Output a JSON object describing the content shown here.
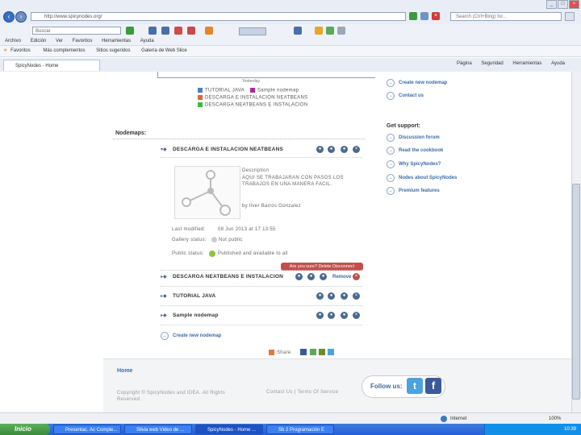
{
  "browser": {
    "address": "http://www.spicynodes.org/",
    "search_placeholder": "Search  (Ctrl+Bing) for...",
    "toolbar_search": "Buscar",
    "menu": [
      "Archivo",
      "Edición",
      "Ver",
      "Favoritos",
      "Herramientas",
      "Ayuda"
    ],
    "favorites_label": "Favoritos",
    "fav_items": [
      "Más complementos",
      "Sitios sugeridos",
      "Galería de Web Slice"
    ],
    "tab_label": "SpicyNodes - Home",
    "cmd_items": [
      "Página",
      "Seguridad",
      "Herramientas",
      "Ayuda"
    ],
    "status_text": "Internet"
  },
  "legend": {
    "items": [
      {
        "label": "TUTORIAL JAVA",
        "color": "#4a7fc1"
      },
      {
        "label": "Sample nodemap",
        "color": "#b3269b"
      },
      {
        "label": "DESCARGA E INSTALACION NEATBEANS",
        "color": "#d86a3c"
      },
      {
        "label": "DESCARGA NEATBEANS E INSTALACION",
        "color": "#33c133"
      }
    ],
    "axis_caption": "Yesterday"
  },
  "nodemaps": {
    "heading": "Nodemaps:",
    "rows": [
      {
        "title": "DESCARGA E INSTALACION NEATBEANS"
      },
      {
        "title": "DESCARGA NEATBEANS E INSTALACION"
      },
      {
        "title": "TUTORIAL JAVA"
      },
      {
        "title": "Sample nodemap"
      }
    ],
    "details": {
      "desc_label": "Description",
      "desc_text": "AQUI SE TRABAJARAN CON PASOS LOS TRABAJOS EN UNA MANERA FACIL.",
      "author": "by Ilver Barros Gonzalez",
      "last_modified_label": "Last modified:",
      "last_modified_value": "08 Jun 2013 at 17:13:55",
      "gallery_label": "Gallery status:",
      "gallery_value": "Not public",
      "public_label": "Public status:",
      "public_value": "Published and available to all"
    },
    "confirm": "Are you sure? Delete  Disconnect",
    "remove": "Remove",
    "create_link": "Create new nodemap",
    "share": "Share"
  },
  "sidebar": {
    "top_links": [
      "Create new nodemap",
      "Contact us"
    ],
    "support_heading": "Get support:",
    "support_links": [
      "Discussion forum",
      "Read the cookbook",
      "Why SpicyNodes?",
      "Nodes about SpicyNodes",
      "Premium features"
    ]
  },
  "footer": {
    "home": "Home",
    "copyright": "Copyright © SpicyNodes and IDEA. All Rights Reserved.",
    "links": "Contact Us  |  Terms Of Service",
    "follow": "Follow us:"
  },
  "taskbar": {
    "start": "Inicio",
    "tasks": [
      "Presentac. Ac Comple...",
      "Silvia web Video de ...",
      "SpicyNodes - Home ...",
      "Sb 2 Programación E"
    ],
    "clock": "10:39"
  }
}
